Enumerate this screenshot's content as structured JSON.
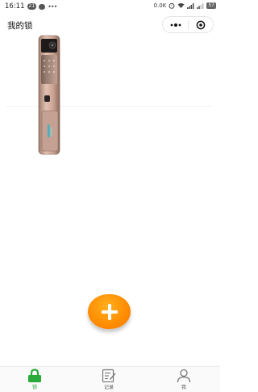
{
  "status_bar": {
    "time": "16:11",
    "badge": "21",
    "network_speed": "0.0K",
    "battery": "57"
  },
  "nav": {
    "title": "我的锁"
  },
  "tabs": [
    {
      "label": "锁",
      "icon": "lock-icon",
      "active": true
    },
    {
      "label": "记录",
      "icon": "record-icon",
      "active": false
    },
    {
      "label": "我",
      "icon": "user-icon",
      "active": false
    }
  ],
  "colors": {
    "accent_green": "#2aaa3a",
    "add_orange": "#ff8c00",
    "lock_body": "#c9a191"
  }
}
